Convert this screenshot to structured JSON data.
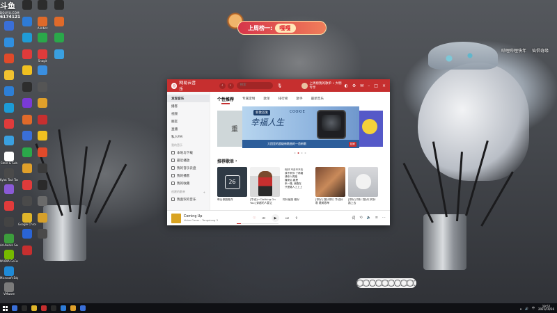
{
  "douyu": {
    "mark": "斗鱼",
    "brand": "DOUYU.COM",
    "room_id": "6174121"
  },
  "rank_banner": {
    "prefix": "上周榜一:",
    "name": "嘎嘎"
  },
  "watermark": {
    "left": "哔哩哔哩快年",
    "right": "仙侣奇缘"
  },
  "desktop_icons_col1": [
    {
      "label": "",
      "color": "#3a6fd8"
    },
    {
      "label": "",
      "color": "#2f8fe0"
    },
    {
      "label": "",
      "color": "#e04a2a"
    },
    {
      "label": "",
      "color": "#f2c230"
    },
    {
      "label": "",
      "color": "#2d7fd6"
    },
    {
      "label": "",
      "color": "#1c9bd6"
    },
    {
      "label": "",
      "color": "#e03b3b"
    },
    {
      "label": "",
      "color": "#3aa0e0"
    },
    {
      "label": "Store & Sub",
      "color": "#ffffff"
    },
    {
      "label": "Kylot Tool Tower",
      "color": "#4a4a4a"
    },
    {
      "label": "",
      "color": "#8a5ad6"
    },
    {
      "label": "",
      "color": "#e03b3b"
    },
    {
      "label": "",
      "color": "#444444"
    },
    {
      "label": "Ad-Aware Security",
      "color": "#3c9d3c"
    },
    {
      "label": "NVIDIA GeForce",
      "color": "#76b900"
    },
    {
      "label": "Microsoft Edge",
      "color": "#1f8ad6"
    },
    {
      "label": "VMware",
      "color": "#7b7b7b"
    }
  ],
  "desktop_icons_col2": [
    {
      "label": "",
      "color": "#2b2b2b"
    },
    {
      "label": "",
      "color": "#2e7bd6"
    },
    {
      "label": "",
      "color": "#1f9bd6"
    },
    {
      "label": "",
      "color": "#e03b3b"
    },
    {
      "label": "",
      "color": "#f0c020"
    },
    {
      "label": "",
      "color": "#2d2d2d"
    },
    {
      "label": "",
      "color": "#7a3ad6"
    },
    {
      "label": "",
      "color": "#e06a2a"
    },
    {
      "label": "",
      "color": "#3a6fd8"
    },
    {
      "label": "",
      "color": "#2aa84a"
    },
    {
      "label": "",
      "color": "#e0a02a"
    },
    {
      "label": "",
      "color": "#e03b3b"
    },
    {
      "label": "",
      "color": "#4a4a4a"
    },
    {
      "label": "Google Chrome",
      "color": "#e0b52a"
    },
    {
      "label": "",
      "color": "#2a64d6"
    },
    {
      "label": "",
      "color": "#c62f2f"
    }
  ],
  "desktop_icons_col3": [
    {
      "label": "",
      "color": "#2c2c2c"
    },
    {
      "label": "Aimbot",
      "color": "#e06a2a"
    },
    {
      "label": "",
      "color": "#2aa84a"
    },
    {
      "label": "Snagit",
      "color": "#e03b3b"
    },
    {
      "label": "",
      "color": "#3a8fe0"
    },
    {
      "label": "",
      "color": "#555555"
    },
    {
      "label": "",
      "color": "#e0a02a"
    },
    {
      "label": "",
      "color": "#c62f2f"
    },
    {
      "label": "",
      "color": "#f0c020"
    },
    {
      "label": "",
      "color": "#e04a2a"
    },
    {
      "label": "",
      "color": "#3a3a3a"
    },
    {
      "label": "",
      "color": "#2a2a2a"
    },
    {
      "label": "",
      "color": "#6a6a6a"
    },
    {
      "label": "",
      "color": "#d6a02a"
    },
    {
      "label": "",
      "color": "#4a4a4a"
    }
  ],
  "desktop_icons_col4": [
    {
      "label": "",
      "color": "#2c2c2c"
    },
    {
      "label": "",
      "color": "#e06a2a"
    },
    {
      "label": "",
      "color": "#2aa84a"
    },
    {
      "label": "",
      "color": "#3aa0e0"
    }
  ],
  "music": {
    "app_name": "网易云音乐",
    "search_placeholder": "搜索",
    "user_name": "上周榜我的歌单 • 大明专享",
    "sidebar": {
      "items": [
        "发现音乐",
        "播客",
        "视频",
        "朋友",
        "直播",
        "私人FM"
      ],
      "my_music_head": "我的音乐",
      "my_music": [
        "本地与下载",
        "最近播放",
        "我的音乐云盘",
        "我的播客",
        "我的收藏"
      ],
      "playlists_head": "创建的歌单",
      "playlists": [
        "我喜欢的音乐"
      ]
    },
    "tabs": [
      "个性推荐",
      "专属定制",
      "歌单",
      "排行榜",
      "歌手",
      "最新音乐"
    ],
    "banner": {
      "side_left_text": "重",
      "tag1": "新歌首发",
      "tag2": "COOKIE",
      "script": "幸福人生",
      "sub": "大团里的超级新歌曲的一首新歌",
      "badge": "独家"
    },
    "section_title": "推荐歌单",
    "section_arrow": "›",
    "cards": [
      {
        "title": "每日歌曲推荐",
        "cover": "calendar",
        "day": "26"
      },
      {
        "title": "[华语]一Clothing On You] 穿越的人要让",
        "cover": "person"
      },
      {
        "title": "你好星座 最好",
        "cover": "text",
        "lines": [
          "你好 不去不不去",
          "我不来你 了再路",
          "请你人再路",
          "播来后 路是",
          "来一路, 我路在",
          "只是路人上上上"
        ]
      },
      {
        "title": "[你好] 我好你们 华语好歌 最美歌单",
        "cover": "warm"
      },
      {
        "title": "[你好] 你好 我好们的好 路上去",
        "cover": "cat"
      }
    ],
    "player": {
      "song": "Coming Up",
      "artist": "Voice Cover - Tongxiong 3",
      "progress": 0.1
    }
  },
  "taskbar": {
    "time": "19:52",
    "date": "2021/10/26",
    "icons": [
      "#3a6fd8",
      "#2a2a2a",
      "#e0b52a",
      "#c62f2f",
      "#2a2a2a",
      "#2e7bd6",
      "#e0a02a",
      "#3a6fd8"
    ]
  }
}
